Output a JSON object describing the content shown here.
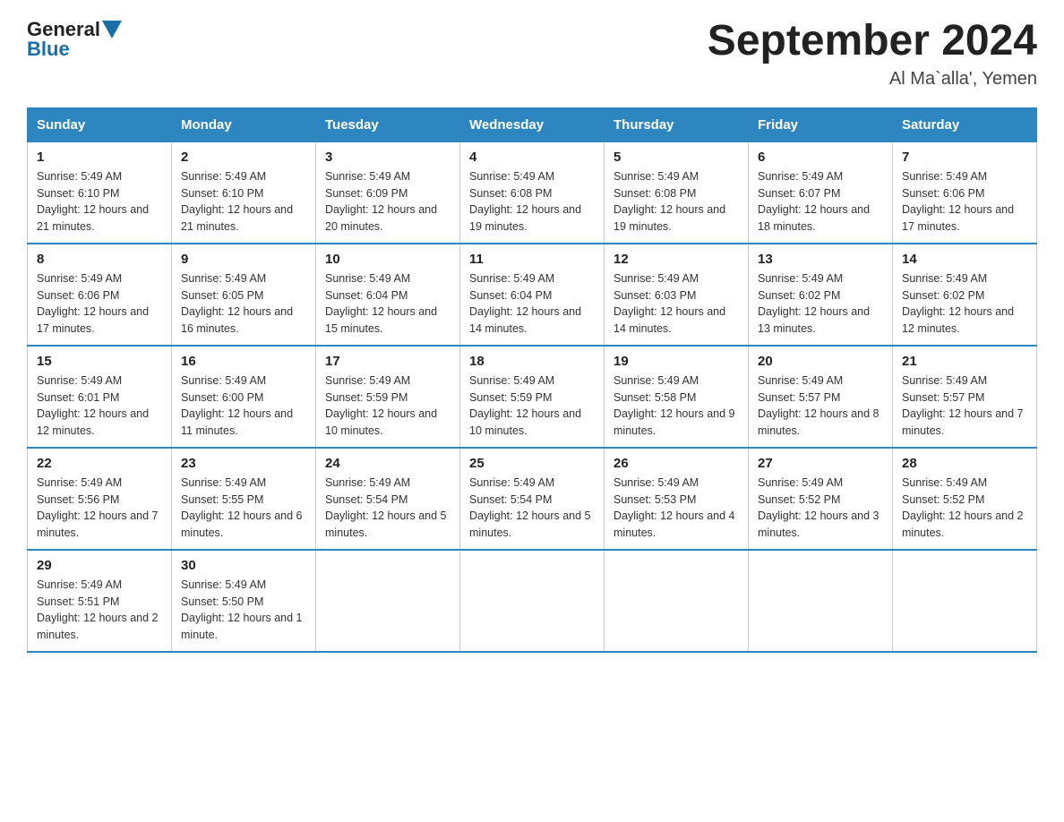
{
  "header": {
    "logo_general": "General",
    "logo_blue": "Blue",
    "month_title": "September 2024",
    "location": "Al Ma`alla', Yemen"
  },
  "weekdays": [
    "Sunday",
    "Monday",
    "Tuesday",
    "Wednesday",
    "Thursday",
    "Friday",
    "Saturday"
  ],
  "weeks": [
    [
      {
        "day": "1",
        "sunrise": "Sunrise: 5:49 AM",
        "sunset": "Sunset: 6:10 PM",
        "daylight": "Daylight: 12 hours and 21 minutes."
      },
      {
        "day": "2",
        "sunrise": "Sunrise: 5:49 AM",
        "sunset": "Sunset: 6:10 PM",
        "daylight": "Daylight: 12 hours and 21 minutes."
      },
      {
        "day": "3",
        "sunrise": "Sunrise: 5:49 AM",
        "sunset": "Sunset: 6:09 PM",
        "daylight": "Daylight: 12 hours and 20 minutes."
      },
      {
        "day": "4",
        "sunrise": "Sunrise: 5:49 AM",
        "sunset": "Sunset: 6:08 PM",
        "daylight": "Daylight: 12 hours and 19 minutes."
      },
      {
        "day": "5",
        "sunrise": "Sunrise: 5:49 AM",
        "sunset": "Sunset: 6:08 PM",
        "daylight": "Daylight: 12 hours and 19 minutes."
      },
      {
        "day": "6",
        "sunrise": "Sunrise: 5:49 AM",
        "sunset": "Sunset: 6:07 PM",
        "daylight": "Daylight: 12 hours and 18 minutes."
      },
      {
        "day": "7",
        "sunrise": "Sunrise: 5:49 AM",
        "sunset": "Sunset: 6:06 PM",
        "daylight": "Daylight: 12 hours and 17 minutes."
      }
    ],
    [
      {
        "day": "8",
        "sunrise": "Sunrise: 5:49 AM",
        "sunset": "Sunset: 6:06 PM",
        "daylight": "Daylight: 12 hours and 17 minutes."
      },
      {
        "day": "9",
        "sunrise": "Sunrise: 5:49 AM",
        "sunset": "Sunset: 6:05 PM",
        "daylight": "Daylight: 12 hours and 16 minutes."
      },
      {
        "day": "10",
        "sunrise": "Sunrise: 5:49 AM",
        "sunset": "Sunset: 6:04 PM",
        "daylight": "Daylight: 12 hours and 15 minutes."
      },
      {
        "day": "11",
        "sunrise": "Sunrise: 5:49 AM",
        "sunset": "Sunset: 6:04 PM",
        "daylight": "Daylight: 12 hours and 14 minutes."
      },
      {
        "day": "12",
        "sunrise": "Sunrise: 5:49 AM",
        "sunset": "Sunset: 6:03 PM",
        "daylight": "Daylight: 12 hours and 14 minutes."
      },
      {
        "day": "13",
        "sunrise": "Sunrise: 5:49 AM",
        "sunset": "Sunset: 6:02 PM",
        "daylight": "Daylight: 12 hours and 13 minutes."
      },
      {
        "day": "14",
        "sunrise": "Sunrise: 5:49 AM",
        "sunset": "Sunset: 6:02 PM",
        "daylight": "Daylight: 12 hours and 12 minutes."
      }
    ],
    [
      {
        "day": "15",
        "sunrise": "Sunrise: 5:49 AM",
        "sunset": "Sunset: 6:01 PM",
        "daylight": "Daylight: 12 hours and 12 minutes."
      },
      {
        "day": "16",
        "sunrise": "Sunrise: 5:49 AM",
        "sunset": "Sunset: 6:00 PM",
        "daylight": "Daylight: 12 hours and 11 minutes."
      },
      {
        "day": "17",
        "sunrise": "Sunrise: 5:49 AM",
        "sunset": "Sunset: 5:59 PM",
        "daylight": "Daylight: 12 hours and 10 minutes."
      },
      {
        "day": "18",
        "sunrise": "Sunrise: 5:49 AM",
        "sunset": "Sunset: 5:59 PM",
        "daylight": "Daylight: 12 hours and 10 minutes."
      },
      {
        "day": "19",
        "sunrise": "Sunrise: 5:49 AM",
        "sunset": "Sunset: 5:58 PM",
        "daylight": "Daylight: 12 hours and 9 minutes."
      },
      {
        "day": "20",
        "sunrise": "Sunrise: 5:49 AM",
        "sunset": "Sunset: 5:57 PM",
        "daylight": "Daylight: 12 hours and 8 minutes."
      },
      {
        "day": "21",
        "sunrise": "Sunrise: 5:49 AM",
        "sunset": "Sunset: 5:57 PM",
        "daylight": "Daylight: 12 hours and 7 minutes."
      }
    ],
    [
      {
        "day": "22",
        "sunrise": "Sunrise: 5:49 AM",
        "sunset": "Sunset: 5:56 PM",
        "daylight": "Daylight: 12 hours and 7 minutes."
      },
      {
        "day": "23",
        "sunrise": "Sunrise: 5:49 AM",
        "sunset": "Sunset: 5:55 PM",
        "daylight": "Daylight: 12 hours and 6 minutes."
      },
      {
        "day": "24",
        "sunrise": "Sunrise: 5:49 AM",
        "sunset": "Sunset: 5:54 PM",
        "daylight": "Daylight: 12 hours and 5 minutes."
      },
      {
        "day": "25",
        "sunrise": "Sunrise: 5:49 AM",
        "sunset": "Sunset: 5:54 PM",
        "daylight": "Daylight: 12 hours and 5 minutes."
      },
      {
        "day": "26",
        "sunrise": "Sunrise: 5:49 AM",
        "sunset": "Sunset: 5:53 PM",
        "daylight": "Daylight: 12 hours and 4 minutes."
      },
      {
        "day": "27",
        "sunrise": "Sunrise: 5:49 AM",
        "sunset": "Sunset: 5:52 PM",
        "daylight": "Daylight: 12 hours and 3 minutes."
      },
      {
        "day": "28",
        "sunrise": "Sunrise: 5:49 AM",
        "sunset": "Sunset: 5:52 PM",
        "daylight": "Daylight: 12 hours and 2 minutes."
      }
    ],
    [
      {
        "day": "29",
        "sunrise": "Sunrise: 5:49 AM",
        "sunset": "Sunset: 5:51 PM",
        "daylight": "Daylight: 12 hours and 2 minutes."
      },
      {
        "day": "30",
        "sunrise": "Sunrise: 5:49 AM",
        "sunset": "Sunset: 5:50 PM",
        "daylight": "Daylight: 12 hours and 1 minute."
      },
      null,
      null,
      null,
      null,
      null
    ]
  ]
}
